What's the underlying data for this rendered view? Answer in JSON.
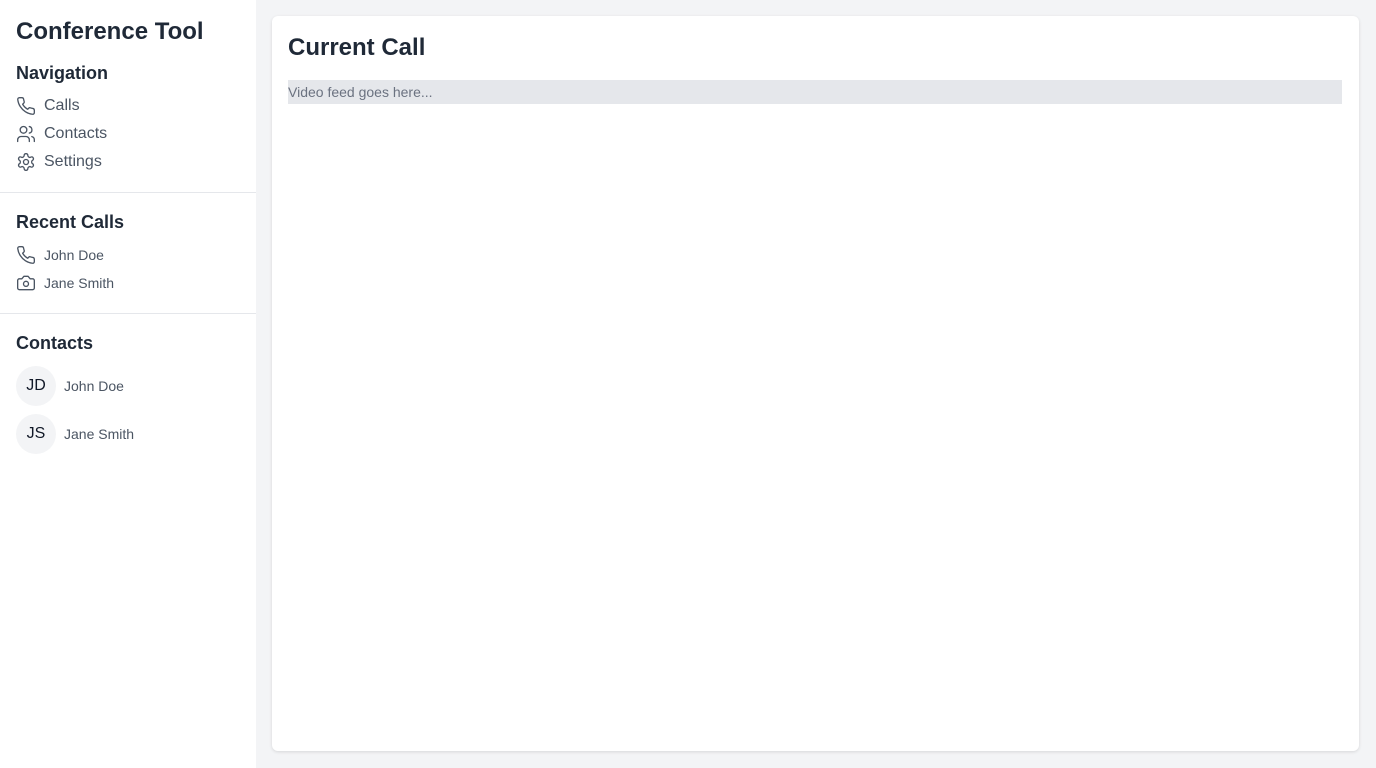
{
  "app": {
    "title": "Conference Tool"
  },
  "navigation": {
    "title": "Navigation",
    "items": [
      {
        "label": "Calls",
        "icon": "phone-icon"
      },
      {
        "label": "Contacts",
        "icon": "users-icon"
      },
      {
        "label": "Settings",
        "icon": "gear-icon"
      }
    ]
  },
  "recent_calls": {
    "title": "Recent Calls",
    "items": [
      {
        "name": "John Doe",
        "icon": "phone-icon"
      },
      {
        "name": "Jane Smith",
        "icon": "camera-icon"
      }
    ]
  },
  "contacts": {
    "title": "Contacts",
    "items": [
      {
        "initials": "JD",
        "name": "John Doe"
      },
      {
        "initials": "JS",
        "name": "Jane Smith"
      }
    ]
  },
  "main": {
    "title": "Current Call",
    "video_placeholder": "Video feed goes here..."
  },
  "colors": {
    "background": "#f3f4f6",
    "sidebar": "#ffffff",
    "text": "#1f2937",
    "muted": "#4b5563",
    "placeholder_bg": "#e5e7eb"
  }
}
